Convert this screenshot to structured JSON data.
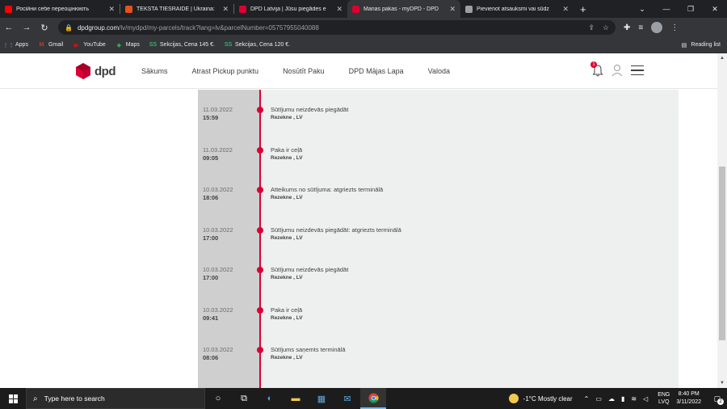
{
  "browser": {
    "tabs": [
      {
        "title": "Російни себе переоцінюють",
        "favicon_color": "#ff0000",
        "active": false
      },
      {
        "title": "TEKSTA TIEŠRAIDE | Ukraina:",
        "favicon_color": "#e8501e",
        "active": false
      },
      {
        "title": "DPD Latvija | Jūsu piegādes e",
        "favicon_color": "#dc0032",
        "active": false
      },
      {
        "title": "Manas pakas - myDPD - DPD",
        "favicon_color": "#dc0032",
        "active": true
      },
      {
        "title": "Pievienot atsauksmi vai sūdz",
        "favicon_color": "#9aa0a6",
        "active": false
      }
    ],
    "new_tab_label": "+",
    "url_host": "dpdgroup.com",
    "url_path": "/lv/mydpd/my-parcels/track?lang=lv&parcelNumber=05757955040088",
    "bookmarks": [
      {
        "label": "Apps",
        "icon": "apps-grid-icon",
        "color": "#8ab4f8"
      },
      {
        "label": "Gmail",
        "icon": "gmail-icon",
        "color": "#ea4335"
      },
      {
        "label": "YouTube",
        "icon": "youtube-icon",
        "color": "#ff0000"
      },
      {
        "label": "Maps",
        "icon": "maps-icon",
        "color": "#34a853"
      },
      {
        "label": "Sekcijas, Cena 145 €.",
        "icon": "ss-icon",
        "color": "#3ddc84"
      },
      {
        "label": "Sekcijas, Cena 120 €.",
        "icon": "ss-icon",
        "color": "#3ddc84"
      }
    ],
    "reading_list_label": "Reading list"
  },
  "site": {
    "logo_text": "dpd",
    "brand_color": "#dc0032",
    "nav": [
      "Sākums",
      "Atrast Pickup punktu",
      "Nosūtīt Paku",
      "DPD Mājas Lapa",
      "Valoda"
    ],
    "notification_count": "1"
  },
  "events": [
    {
      "date": "11.03.2022",
      "time": "15:59",
      "title": "Sūtījumu neizdevās piegādāt",
      "location": "Rezekne , LV"
    },
    {
      "date": "11.03.2022",
      "time": "09:05",
      "title": "Paka ir ceļā",
      "location": "Rezekne , LV"
    },
    {
      "date": "10.03.2022",
      "time": "18:06",
      "title": "Atteikums no sūtījuma: atgriezts terminālā",
      "location": "Rezekne , LV"
    },
    {
      "date": "10.03.2022",
      "time": "17:00",
      "title": "Sūtījumu neizdevās piegādāt: atgriezts terminālā",
      "location": "Rezekne , LV"
    },
    {
      "date": "10.03.2022",
      "time": "17:00",
      "title": "Sūtījumu neizdevās piegādāt",
      "location": "Rezekne , LV"
    },
    {
      "date": "10.03.2022",
      "time": "09:41",
      "title": "Paka ir ceļā",
      "location": "Rezekne , LV"
    },
    {
      "date": "10.03.2022",
      "time": "08:06",
      "title": "Sūtījums saņemts terminālā",
      "location": "Rezekne , LV"
    }
  ],
  "taskbar": {
    "search_placeholder": "Type here to search",
    "weather": "-1°C  Mostly clear",
    "lang_top": "ENG",
    "lang_bottom": "LVQ",
    "time": "8:40 PM",
    "date": "3/11/2022",
    "notification_count": "2"
  }
}
